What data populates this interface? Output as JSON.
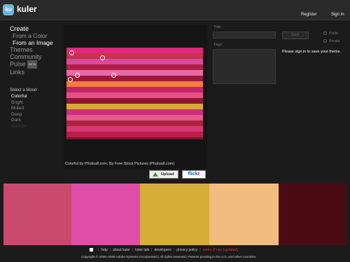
{
  "header": {
    "logo_badge": "ku",
    "logo_text": "kuler",
    "register": "Register",
    "sign_in": "Sign In"
  },
  "nav": {
    "create": "Create",
    "from_color": "From a Color",
    "from_image": "From an Image",
    "themes": "Themes",
    "community": "Community",
    "pulse": "Pulse",
    "pulse_badge": "BETA",
    "links": "Links"
  },
  "mood": {
    "heading": "Select a Mood",
    "items": [
      "Colorful",
      "Bright",
      "Muted",
      "Deep",
      "Dark",
      "Custom"
    ],
    "selected": "Colorful"
  },
  "image": {
    "caption": "Colorful by Photos8.com, By Free Stock Pictures (Photos8.com)",
    "upload_label": "Upload",
    "flickr_part1": "flick",
    "flickr_part2": "r"
  },
  "form": {
    "title_label": "Title:",
    "tags_label": "Tags:",
    "title_value": "",
    "tags_value": "",
    "save_label": "Save",
    "public_label": "Public",
    "private_label": "Private",
    "signin_message": "Please sign in to save your theme."
  },
  "swatches": [
    "#c94a6e",
    "#de4da8",
    "#d6ad38",
    "#f1bd7e",
    "#4a0c12"
  ],
  "footer": {
    "links": [
      "help",
      "about kuler",
      "kuler talk",
      "developers",
      "privacy policy",
      "terms of use (updated)"
    ],
    "copyright": "Copyright © 2006–2008 Adobe Systems Incorporated | All rights reserved | Patents pending in the U.S. and other countries"
  },
  "colors": {
    "background": "#1b1b1b",
    "accent": "#6fb7e0",
    "terms_link": "#e03030"
  }
}
